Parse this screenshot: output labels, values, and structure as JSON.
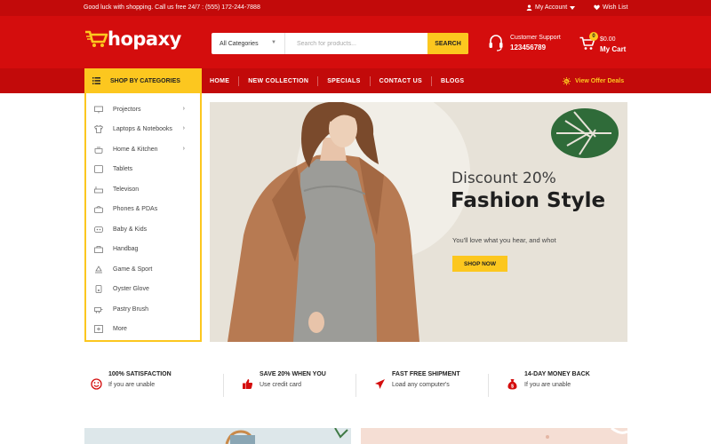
{
  "topbar": {
    "promo_text": "Good luck with shopping. Call us free 24/7 : (555) 172-244-7888",
    "account_label": "My Account",
    "wishlist_label": "Wish List"
  },
  "header": {
    "logo_text": "hopaxy",
    "search": {
      "category_value": "All Categories",
      "placeholder": "Search for products...",
      "button_label": "SEARCH"
    },
    "support": {
      "label": "Customer Support",
      "phone": "123456789"
    },
    "cart": {
      "count": "0",
      "amount": "$0.00",
      "label": "My Cart"
    }
  },
  "nav": {
    "categories_button": "SHOP BY CATEGORIES",
    "links": [
      "HOME",
      "NEW COLLECTION",
      "SPECIALS",
      "CONTACT US",
      "BLOGS"
    ],
    "offer_label": "View Offer Deals"
  },
  "categories": [
    {
      "label": "Projectors",
      "icon": "projector-icon",
      "has_submenu": true
    },
    {
      "label": "Laptops & Notebooks",
      "icon": "tshirt-icon",
      "has_submenu": true
    },
    {
      "label": "Home & Kitchen",
      "icon": "cooking-pot-icon",
      "has_submenu": true
    },
    {
      "label": "Tablets",
      "icon": "tablet-icon",
      "has_submenu": false
    },
    {
      "label": "Televison",
      "icon": "television-icon",
      "has_submenu": false
    },
    {
      "label": "Phones & PDAs",
      "icon": "phone-icon",
      "has_submenu": false
    },
    {
      "label": "Baby & Kids",
      "icon": "baby-icon",
      "has_submenu": false
    },
    {
      "label": "Handbag",
      "icon": "handbag-icon",
      "has_submenu": false
    },
    {
      "label": "Game & Sport",
      "icon": "sport-icon",
      "has_submenu": false
    },
    {
      "label": "Oyster Glove",
      "icon": "glove-icon",
      "has_submenu": false
    },
    {
      "label": "Pastry Brush",
      "icon": "brush-icon",
      "has_submenu": false
    },
    {
      "label": "More",
      "icon": "plus-box-icon",
      "has_submenu": false
    }
  ],
  "hero": {
    "discount": "Discount 20%",
    "title": "Fashion Style",
    "subtitle": "You'll love what you hear, and whot",
    "button_label": "SHOP NOW"
  },
  "features": [
    {
      "title": "100% SATISFACTION",
      "desc": "If you are unable",
      "icon": "smiley-icon"
    },
    {
      "title": "SAVE 20% WHEN YOU",
      "desc": "Use credit card",
      "icon": "thumbs-up-icon"
    },
    {
      "title": "FAST FREE SHIPMENT",
      "desc": "Load any computer's",
      "icon": "airplane-icon"
    },
    {
      "title": "14-DAY MONEY BACK",
      "desc": "If you are unable",
      "icon": "money-bag-icon"
    }
  ],
  "colors": {
    "brand_red": "#d40d0d",
    "dark_red": "#c20a0a",
    "accent_yellow": "#fcc71f",
    "hero_bg": "#e7e2d8"
  }
}
